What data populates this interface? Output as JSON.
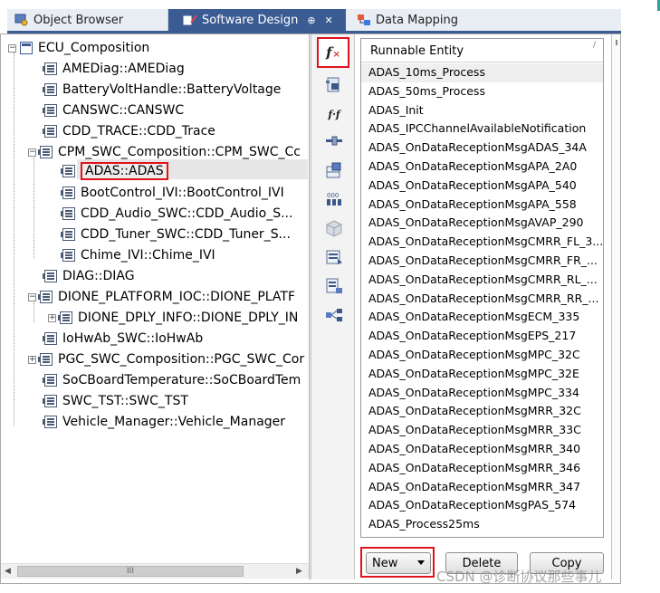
{
  "tabs": [
    {
      "label": "Object Browser",
      "icon": "object-browser-icon",
      "active": false
    },
    {
      "label": "Software Design",
      "icon": "software-design-icon",
      "active": true,
      "pin": "⊕",
      "close": "✕"
    },
    {
      "label": "Data Mapping",
      "icon": "data-mapping-icon",
      "active": false
    }
  ],
  "tree": {
    "root": {
      "label": "ECU_Composition",
      "expander": "−"
    },
    "nodes": [
      {
        "label": "AMEDiag::AMEDiag"
      },
      {
        "label": "BatteryVoltHandle::BatteryVoltage"
      },
      {
        "label": "CANSWC::CANSWC"
      },
      {
        "label": "CDD_TRACE::CDD_Trace"
      },
      {
        "label": "CPM_SWC_Composition::CPM_SWC_Cc",
        "expander": "−"
      },
      {
        "label": "ADAS::ADAS",
        "selected": true
      },
      {
        "label": "BootControl_IVI::BootControl_IVI"
      },
      {
        "label": "CDD_Audio_SWC::CDD_Audio_S..."
      },
      {
        "label": "CDD_Tuner_SWC::CDD_Tuner_S..."
      },
      {
        "label": "Chime_IVI::Chime_IVI"
      },
      {
        "label": "DIAG::DIAG"
      },
      {
        "label": "DIONE_PLATFORM_IOC::DIONE_PLATF",
        "expander": "−"
      },
      {
        "label": "DIONE_DPLY_INFO::DIONE_DPLY_IN",
        "expander": "+"
      },
      {
        "label": "IoHwAb_SWC::IoHwAb"
      },
      {
        "label": "PGC_SWC_Composition::PGC_SWC_Cor",
        "expander": "+"
      },
      {
        "label": "SoCBoardTemperature::SoCBoardTem"
      },
      {
        "label": "SWC_TST::SWC_TST"
      },
      {
        "label": "Vehicle_Manager::Vehicle_Manager"
      }
    ],
    "hscroll": {
      "left_arrow": "◀",
      "right_arrow": "▶",
      "thumb_grip": "III"
    }
  },
  "toolbar": {
    "buttons": [
      {
        "name": "runnable-entity-button",
        "icon": "fx-icon"
      },
      {
        "name": "port-button",
        "icon": "port-icon"
      },
      {
        "name": "function-call-button",
        "icon": "fx-to-fx-icon"
      },
      {
        "name": "connector-button",
        "icon": "connector-icon"
      },
      {
        "name": "grid-button",
        "icon": "grid-icon"
      },
      {
        "name": "data-elements-button",
        "icon": "data-elements-icon"
      },
      {
        "name": "cube-button",
        "icon": "cube-icon"
      },
      {
        "name": "mapping-button",
        "icon": "mapping-icon"
      },
      {
        "name": "list-mapping-button",
        "icon": "list-mapping-icon"
      },
      {
        "name": "network-button",
        "icon": "network-icon"
      }
    ],
    "fx_label": "f",
    "fx_sub": "×",
    "fxfx_label": "f·f"
  },
  "runnables": {
    "header": "Runnable Entity",
    "sort_glyph": "/",
    "items": [
      "ADAS_10ms_Process",
      "ADAS_50ms_Process",
      "ADAS_Init",
      "ADAS_IPCChannelAvailableNotification",
      "ADAS_OnDataReceptionMsgADAS_34A",
      "ADAS_OnDataReceptionMsgAPA_2A0",
      "ADAS_OnDataReceptionMsgAPA_540",
      "ADAS_OnDataReceptionMsgAPA_558",
      "ADAS_OnDataReceptionMsgAVAP_290",
      "ADAS_OnDataReceptionMsgCMRR_FL_3...",
      "ADAS_OnDataReceptionMsgCMRR_FR_...",
      "ADAS_OnDataReceptionMsgCMRR_RL_...",
      "ADAS_OnDataReceptionMsgCMRR_RR_...",
      "ADAS_OnDataReceptionMsgECM_335",
      "ADAS_OnDataReceptionMsgEPS_217",
      "ADAS_OnDataReceptionMsgMPC_32C",
      "ADAS_OnDataReceptionMsgMPC_32E",
      "ADAS_OnDataReceptionMsgMPC_334",
      "ADAS_OnDataReceptionMsgMRR_32C",
      "ADAS_OnDataReceptionMsgMRR_33C",
      "ADAS_OnDataReceptionMsgMRR_340",
      "ADAS_OnDataReceptionMsgMRR_346",
      "ADAS_OnDataReceptionMsgMRR_347",
      "ADAS_OnDataReceptionMsgPAS_574",
      "ADAS_Process25ms"
    ]
  },
  "buttons": {
    "new_label": "New",
    "delete_label": "Delete",
    "copy_label": "Copy"
  },
  "watermark": "CSDN @诊断协议那些事儿",
  "colors": {
    "active_tab": "#3b5b93",
    "highlight": "#e0121b"
  }
}
